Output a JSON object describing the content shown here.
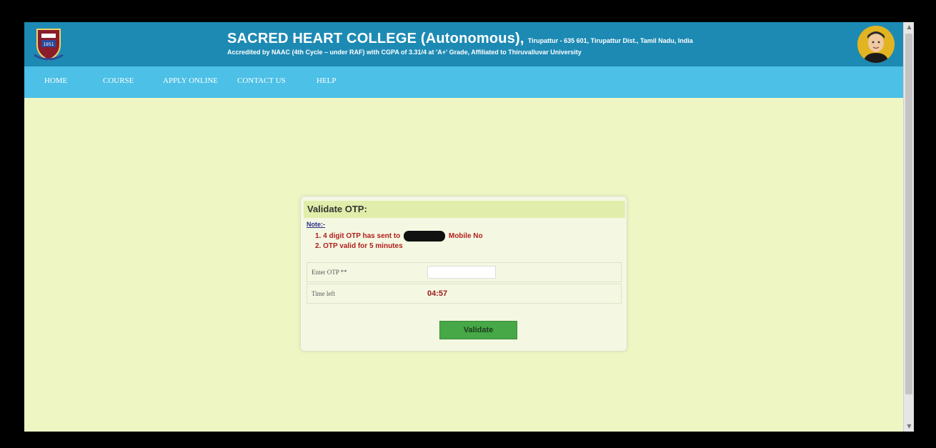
{
  "header": {
    "college_name": "SACRED HEART COLLEGE (Autonomous),",
    "address": "Tirupattur - 635 601, Tirupattur Dist., Tamil Nadu, India",
    "accreditation": "Accredited by NAAC (4th Cycle – under RAF) with CGPA of 3.31/4 at 'A+' Grade, Affiliated to Thiruvalluvar University",
    "logo_icon": "college-crest-icon",
    "avatar_icon": "person-portrait-icon",
    "colors": {
      "header_bg": "#1d8ab4",
      "nav_bg": "#4cc0e6",
      "page_bg": "#eef6c4"
    }
  },
  "nav": {
    "items": [
      {
        "label": "HOME"
      },
      {
        "label": "COURSE"
      },
      {
        "label": "APPLY ONLINE"
      },
      {
        "label": "CONTACT US"
      },
      {
        "label": "HELP"
      }
    ]
  },
  "otp_panel": {
    "title": "Validate OTP:",
    "note_label": "Note:-",
    "note_line1_prefix": "1. 4 digit OTP has sent to",
    "note_line1_suffix": "Mobile No",
    "note_line2": "2. OTP valid for 5 minutes",
    "otp_label": "Enter OTP **",
    "otp_value": "",
    "otp_placeholder": "",
    "time_label": "Time left",
    "time_value": "04:57",
    "validate_label": "Validate",
    "colors": {
      "note_text": "#b21d1d",
      "button": "#46a846",
      "title_bar": "#e1eeab"
    }
  }
}
